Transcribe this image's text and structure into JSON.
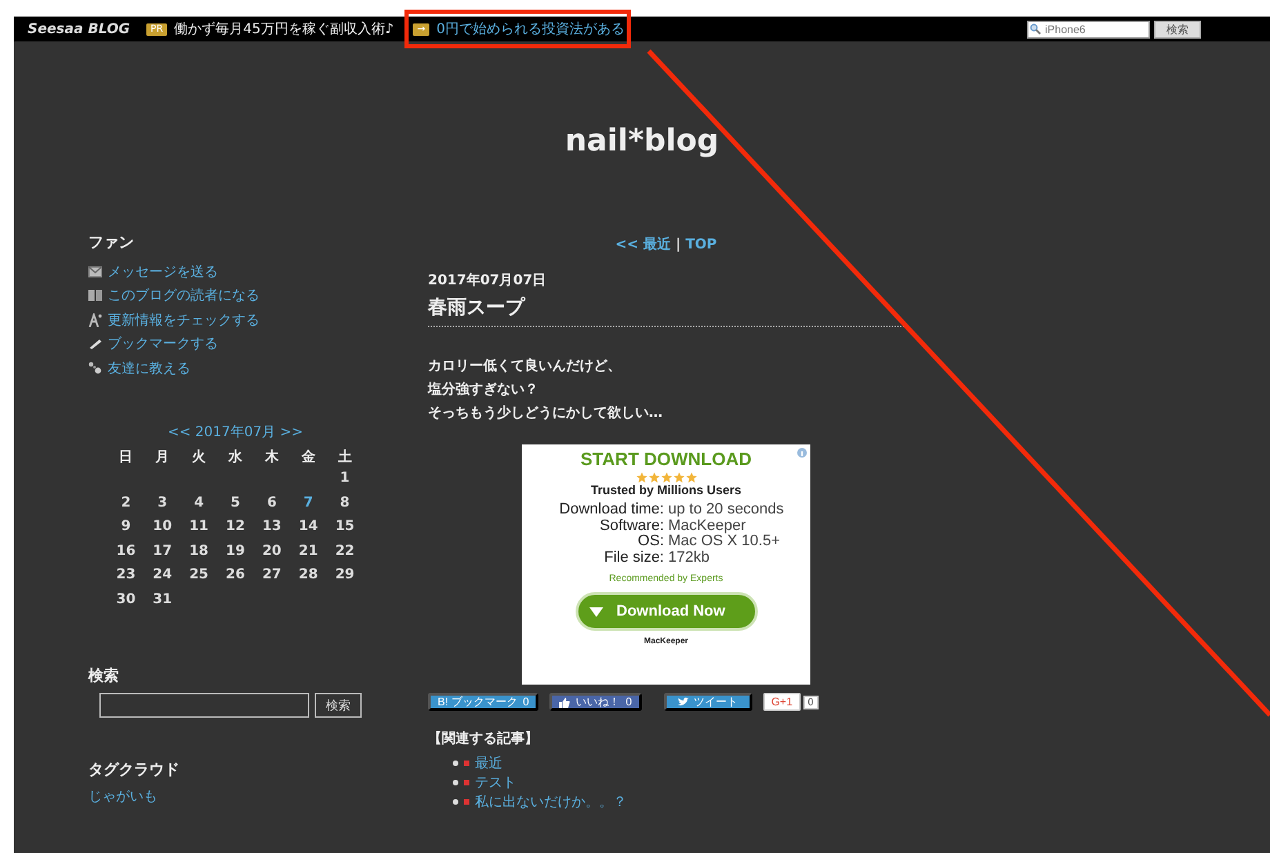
{
  "top_bar": {
    "logo": "Seesaa BLOG",
    "ads": [
      {
        "badge": "PR",
        "text": "働かず毎月45万円を稼ぐ副収入術♪",
        "kind": "pr"
      },
      {
        "badge": "→",
        "text": "0円で始められる投資法がある",
        "kind": "arrow"
      }
    ],
    "search": {
      "placeholder": "iPhone6",
      "button": "検索"
    }
  },
  "blog_title": "nail*blog",
  "sidebar": {
    "fan": {
      "heading": "ファン",
      "links": [
        {
          "label": "メッセージを送る",
          "kind": "message"
        },
        {
          "label": "このブログの読者になる",
          "kind": "reader"
        },
        {
          "label": "更新情報をチェックする",
          "kind": "update"
        },
        {
          "label": "ブックマークする",
          "kind": "bookmark"
        },
        {
          "label": "友達に教える",
          "kind": "friends"
        }
      ]
    },
    "calendar": {
      "prev": "<<",
      "month": "2017年07月",
      "next": ">>",
      "weekdays": [
        "日",
        "月",
        "火",
        "水",
        "木",
        "金",
        "土"
      ],
      "weeks": [
        {
          "kind": "first",
          "days": [
            {
              "day": "1",
              "linked": false
            }
          ]
        },
        {
          "kind": "full",
          "days": [
            {
              "day": "2",
              "linked": false
            },
            {
              "day": "3",
              "linked": false
            },
            {
              "day": "4",
              "linked": false
            },
            {
              "day": "5",
              "linked": false
            },
            {
              "day": "6",
              "linked": false
            },
            {
              "day": "7",
              "linked": true
            },
            {
              "day": "8",
              "linked": false
            }
          ]
        },
        {
          "kind": "full",
          "days": [
            {
              "day": "9",
              "linked": false
            },
            {
              "day": "10",
              "linked": false
            },
            {
              "day": "11",
              "linked": false
            },
            {
              "day": "12",
              "linked": false
            },
            {
              "day": "13",
              "linked": false
            },
            {
              "day": "14",
              "linked": false
            },
            {
              "day": "15",
              "linked": false
            }
          ]
        },
        {
          "kind": "full",
          "days": [
            {
              "day": "16",
              "linked": false
            },
            {
              "day": "17",
              "linked": false
            },
            {
              "day": "18",
              "linked": false
            },
            {
              "day": "19",
              "linked": false
            },
            {
              "day": "20",
              "linked": false
            },
            {
              "day": "21",
              "linked": false
            },
            {
              "day": "22",
              "linked": false
            }
          ]
        },
        {
          "kind": "full",
          "days": [
            {
              "day": "23",
              "linked": false
            },
            {
              "day": "24",
              "linked": false
            },
            {
              "day": "25",
              "linked": false
            },
            {
              "day": "26",
              "linked": false
            },
            {
              "day": "27",
              "linked": false
            },
            {
              "day": "28",
              "linked": false
            },
            {
              "day": "29",
              "linked": false
            }
          ]
        },
        {
          "kind": "last",
          "days": [
            {
              "day": "30",
              "linked": false
            },
            {
              "day": "31",
              "linked": false
            }
          ]
        }
      ]
    },
    "search": {
      "heading": "検索",
      "button": "検索"
    },
    "tag_cloud": {
      "heading": "タグクラウド",
      "tags": [
        "じゃがいも"
      ]
    }
  },
  "main": {
    "nav": {
      "prev": "<< 最近",
      "separator": "|",
      "top": "TOP"
    },
    "date": "2017年07月07日",
    "title": "春雨スープ",
    "body": [
      "カロリー低くて良いんだけど、",
      "塩分強すぎない？",
      "そっちもう少しどうにかして欲しい…"
    ],
    "ad": {
      "headline": "START DOWNLOAD",
      "stars": 5,
      "tagline": "Trusted by Millions Users",
      "specs": [
        {
          "key": "Download time:",
          "value": "up to 20 seconds"
        },
        {
          "key": "Software:",
          "value": "MacKeeper"
        },
        {
          "key": "OS:",
          "value": "Mac OS X 10.5+"
        },
        {
          "key": "File size:",
          "value": "172kb"
        }
      ],
      "note": "Recommended by Experts",
      "button": "Download Now",
      "brand": "MacKeeper"
    },
    "share": [
      {
        "kind": "hatena",
        "label": "B! ブックマーク",
        "count": "0"
      },
      {
        "kind": "like",
        "label": "いいね！",
        "count": "0"
      },
      {
        "kind": "tweet",
        "label": "ツイート"
      },
      {
        "kind": "gplus",
        "label": "G+1",
        "count": "0"
      }
    ],
    "related": {
      "heading": "【関連する記事】",
      "items": [
        "最近",
        "テスト",
        "私に出ないだけか。。？"
      ]
    }
  }
}
